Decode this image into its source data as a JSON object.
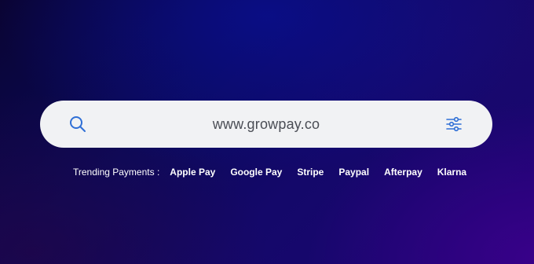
{
  "search": {
    "value": "www.growpay.co",
    "icon": "search-icon",
    "filter_icon": "sliders-icon",
    "accent_color": "#2f6fd6"
  },
  "trending": {
    "label": "Trending Payments :",
    "items": [
      "Apple Pay",
      "Google Pay",
      "Stripe",
      "Paypal",
      "Afterpay",
      "Klarna"
    ]
  }
}
